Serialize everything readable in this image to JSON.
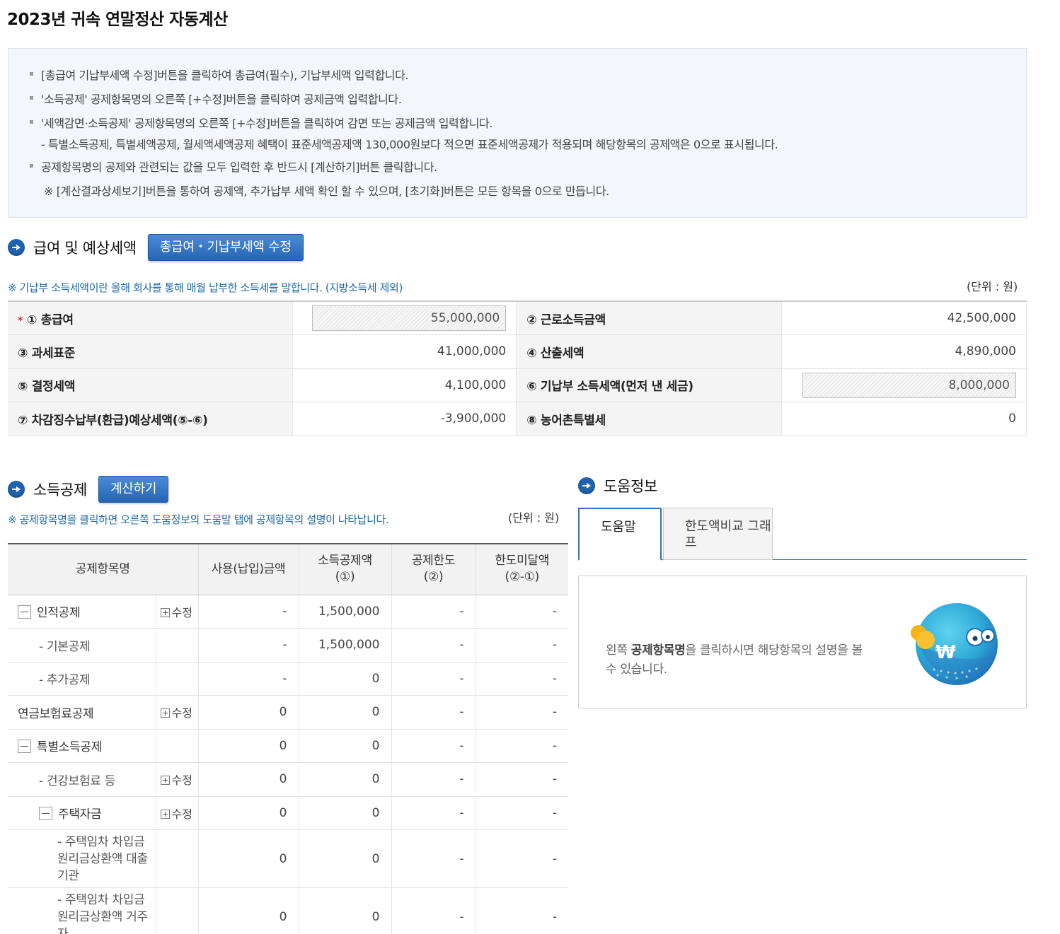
{
  "page_title": "2023년 귀속 연말정산 자동계산",
  "notice": {
    "line1": "[총급여 기납부세액 수정]버튼을 클릭하여 총급여(필수), 기납부세액 입력합니다.",
    "line2": "'소득공제' 공제항목명의 오른쪽 [+수정]버튼을 클릭하여 공제금액 입력합니다.",
    "line3": "'세액감면·소득공제' 공제항목명의 오른쪽 [+수정]버튼을 클릭하여 감면 또는 공제금액 입력합니다.",
    "line4": "- 특별소득공제, 특별세액공제, 월세액세액공제 혜택이 표준세액공제액 130,000원보다 적으면 표준세액공제가 적용되며 해당항목의 공제액은 0으로 표시됩니다.",
    "line5": "공제항목명의 공제와 관련되는 값을 모두 입력한 후 반드시 [계산하기]버튼 클릭합니다.",
    "line6": "※ [계산결과상세보기]버튼을 통하여 공제액, 추가납부 세액 확인 할 수 있으며, [초기화]버튼은 모든 항목을 0으로 만듭니다."
  },
  "salary": {
    "title": "급여 및 예상세액",
    "edit_button": "총급여・기납부세액 수정",
    "note": "※ 기납부 소득세액이란 올해 회사를 통해 매월 납부한 소득세를 말합니다. (지방소득세 제외)",
    "unit": "(단위 : 원)",
    "req_mark": "*",
    "r1_l1": "① 총급여",
    "r1_v1": "55,000,000",
    "r1_l2": "② 근로소득금액",
    "r1_v2": "42,500,000",
    "r2_l1": "③ 과세표준",
    "r2_v1": "41,000,000",
    "r2_l2": "④ 산출세액",
    "r2_v2": "4,890,000",
    "r3_l1": "⑤ 결정세액",
    "r3_v1": "4,100,000",
    "r3_l2": "⑥ 기납부 소득세액(먼저 낸 세금)",
    "r3_v2": "8,000,000",
    "r4_l1": "⑦ 차감징수납부(환급)예상세액(⑤-⑥)",
    "r4_v1": "-3,900,000",
    "r4_l2": "⑧ 농어촌특별세",
    "r4_v2": "0"
  },
  "deduction": {
    "title": "소득공제",
    "calc_button": "계산하기",
    "note": "※ 공제항목명을 클릭하면 오른쪽 도움정보의 도움말 탭에 공제항목의 설명이 나타납니다.",
    "unit": "(단위 : 원)",
    "edit_label": "수정",
    "headers": {
      "item": "공제항목명",
      "used": "사용(납입)금액",
      "amount": "소득공제액(①)",
      "limit": "공제한도(②)",
      "remain": "한도미달액(②-①)"
    },
    "rows": [
      {
        "name": "인적공제",
        "used": "-",
        "amount": "1,500,000",
        "limit": "-",
        "remain": "-"
      },
      {
        "name": "- 기본공제",
        "used": "-",
        "amount": "1,500,000",
        "limit": "-",
        "remain": "-"
      },
      {
        "name": "- 추가공제",
        "used": "-",
        "amount": "0",
        "limit": "-",
        "remain": "-"
      },
      {
        "name": "연금보험료공제",
        "used": "0",
        "amount": "0",
        "limit": "-",
        "remain": "-"
      },
      {
        "name": "특별소득공제",
        "used": "0",
        "amount": "0",
        "limit": "-",
        "remain": "-"
      },
      {
        "name": "- 건강보험료 등",
        "used": "0",
        "amount": "0",
        "limit": "-",
        "remain": "-"
      },
      {
        "name": "주택자금",
        "used": "0",
        "amount": "0",
        "limit": "-",
        "remain": "-"
      },
      {
        "name": "- 주택임차 차입금 원리금상환액 대출기관",
        "used": "0",
        "amount": "0",
        "limit": "-",
        "remain": "-"
      },
      {
        "name": "- 주택임차 차입금 원리금상환액 거주자",
        "used": "0",
        "amount": "0",
        "limit": "-",
        "remain": "-"
      }
    ]
  },
  "help": {
    "title": "도움정보",
    "tab1": "도움말",
    "tab2": "한도액비교 그래프",
    "text_pre": "왼쪽 ",
    "text_bold": "공제항목명",
    "text_post": "을 클릭하시면 해당항목의 설명을 볼 수 있습니다."
  },
  "colors": {
    "accent": "#2765b4",
    "note": "#1e6aa8",
    "required": "#d9232a"
  }
}
